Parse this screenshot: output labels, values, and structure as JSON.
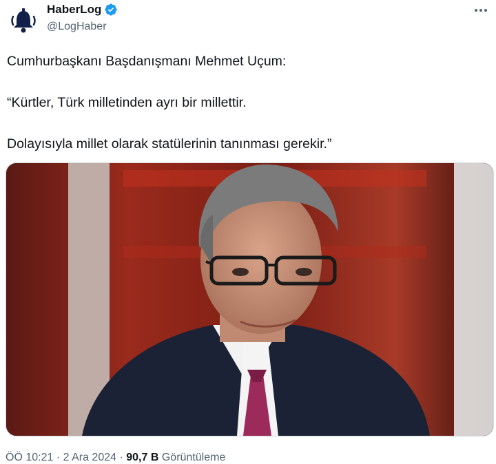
{
  "author": {
    "name": "HaberLog",
    "handle": "@LogHaber",
    "avatar_icon": "bell-icon",
    "verified_icon": "verified-badge-icon",
    "verified_color": "#1d9bf0"
  },
  "more_icon": "more-dots-icon",
  "tweet": {
    "lines": [
      "Cumhurbaşkanı Başdanışmanı Mehmet Uçum:",
      "“Kürtler, Türk milletinden ayrı bir millettir.",
      "Dolayısıyla millet olarak statülerinin tanınması gerekir.”"
    ]
  },
  "media": {
    "description_icon": "photo-man-in-suit"
  },
  "footer": {
    "time": "ÖÖ 10:21",
    "separator": "·",
    "date": "2 Ara 2024",
    "views_count": "90,7 B",
    "views_label": "Görüntüleme"
  },
  "colors": {
    "text": "#0f1419",
    "secondary": "#536471",
    "accent": "#1d9bf0"
  }
}
